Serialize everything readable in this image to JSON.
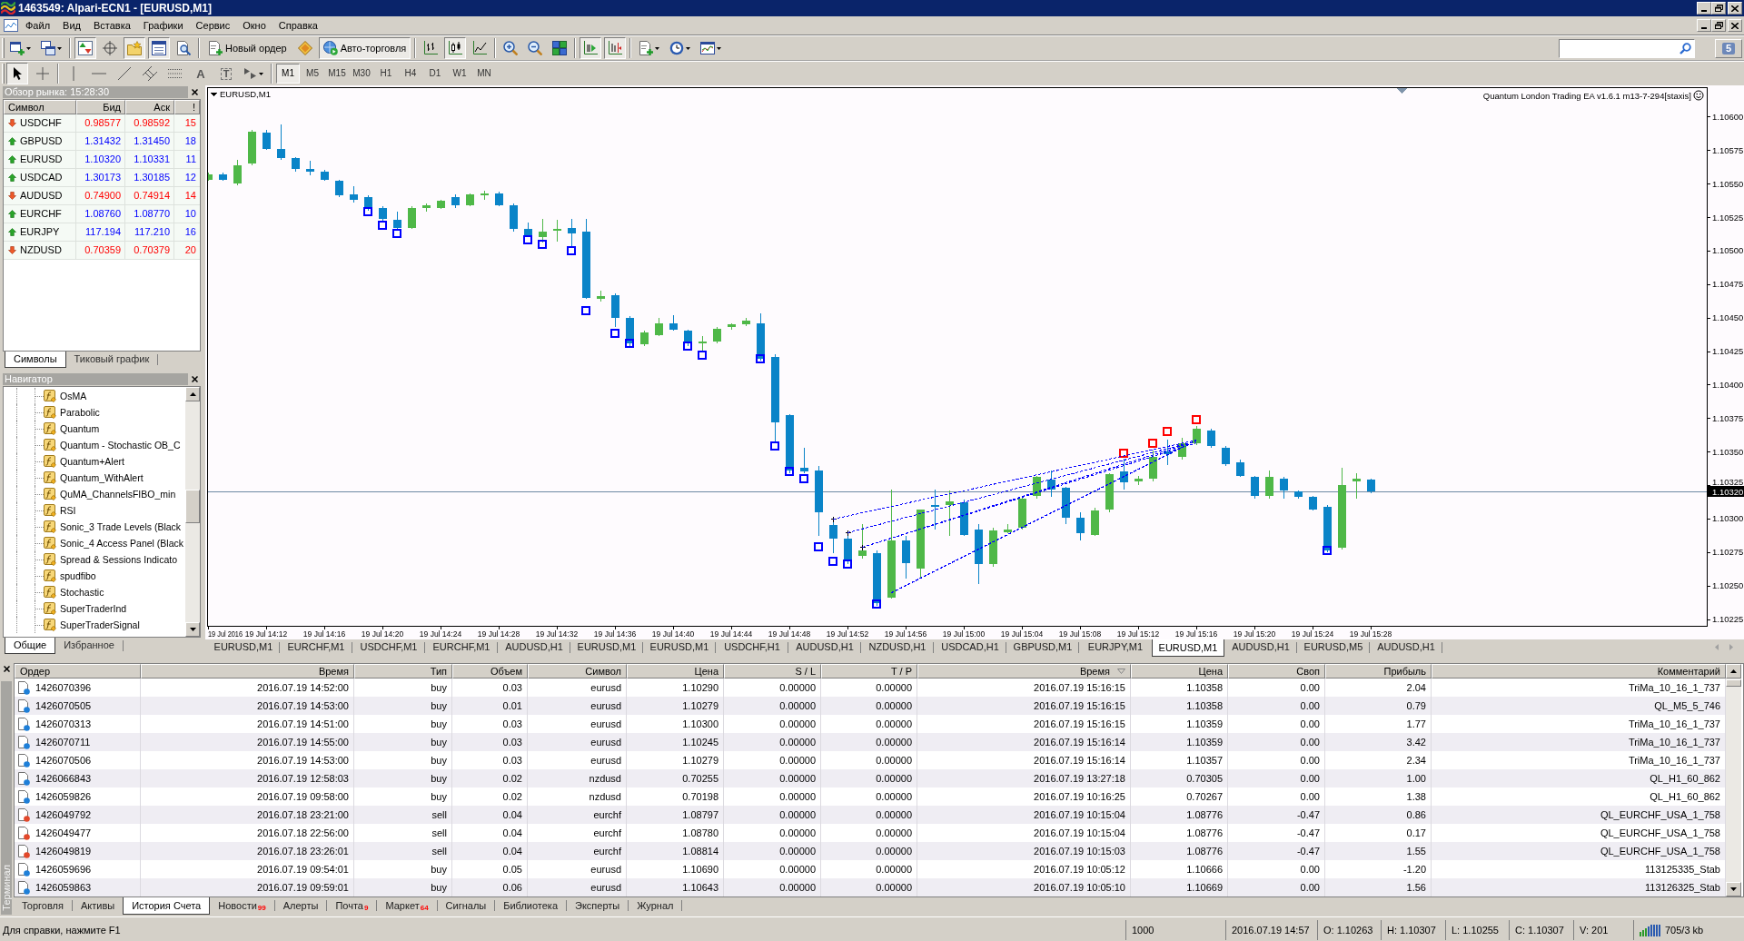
{
  "window": {
    "title": "1463549: Alpari-ECN1 - [EURUSD,M1]"
  },
  "menu": [
    "Файл",
    "Вид",
    "Вставка",
    "Графики",
    "Сервис",
    "Окно",
    "Справка"
  ],
  "toolbar": {
    "groups": [
      [
        {
          "kind": "icon",
          "on": false
        },
        {
          "kind": "icon",
          "on": false
        }
      ],
      [
        {
          "kind": "icon",
          "on": true
        },
        {
          "kind": "icon",
          "on": false
        },
        {
          "kind": "icon",
          "on": true
        },
        {
          "kind": "icon",
          "on": true
        },
        {
          "kind": "icon",
          "on": false
        }
      ],
      [
        {
          "kind": "button",
          "label": "Новый ордер",
          "on": false
        },
        {
          "kind": "icon",
          "on": false
        },
        {
          "kind": "button",
          "label": "Авто-торговля",
          "on": true
        }
      ],
      [
        {
          "kind": "icon",
          "on": false
        },
        {
          "kind": "icon",
          "on": true
        },
        {
          "kind": "icon",
          "on": false
        }
      ],
      [
        {
          "kind": "icon",
          "on": false
        },
        {
          "kind": "icon",
          "on": false
        },
        {
          "kind": "icon",
          "on": false
        }
      ],
      [
        {
          "kind": "icon",
          "on": true
        },
        {
          "kind": "icon",
          "on": true
        }
      ],
      [
        {
          "kind": "icon",
          "on": false
        },
        {
          "kind": "icon",
          "on": false
        },
        {
          "kind": "icon",
          "on": false
        }
      ]
    ],
    "messages": "5"
  },
  "drawing_toolbar": {
    "groups": [
      [
        {
          "kind": "icon",
          "on": true
        },
        {
          "kind": "icon",
          "on": false
        }
      ],
      [
        {
          "kind": "icon",
          "on": false
        },
        {
          "kind": "icon",
          "on": false
        },
        {
          "kind": "icon",
          "on": false
        },
        {
          "kind": "icon",
          "on": false
        },
        {
          "kind": "icon",
          "on": false
        },
        {
          "kind": "glyph",
          "label": "A",
          "on": false
        },
        {
          "kind": "boxed_glyph",
          "label": "T",
          "on": false
        },
        {
          "kind": "icon",
          "on": false
        }
      ]
    ],
    "timeframes": [
      {
        "label": "M1",
        "selected": true
      },
      {
        "label": "M5",
        "selected": false
      },
      {
        "label": "M15",
        "selected": false
      },
      {
        "label": "M30",
        "selected": false
      },
      {
        "label": "H1",
        "selected": false
      },
      {
        "label": "H4",
        "selected": false
      },
      {
        "label": "D1",
        "selected": false
      },
      {
        "label": "W1",
        "selected": false
      },
      {
        "label": "MN",
        "selected": false
      }
    ]
  },
  "market_watch": {
    "title": "Обзор рынка: 15:28:30",
    "columns": [
      "Символ",
      "Бид",
      "Аск",
      "!"
    ],
    "rows": [
      {
        "symbol": "USDCHF",
        "bid": "0.98577",
        "ask": "0.98592",
        "spread": "15",
        "rising": false
      },
      {
        "symbol": "GBPUSD",
        "bid": "1.31432",
        "ask": "1.31450",
        "spread": "18",
        "rising": true
      },
      {
        "symbol": "EURUSD",
        "bid": "1.10320",
        "ask": "1.10331",
        "spread": "11",
        "rising": true
      },
      {
        "symbol": "USDCAD",
        "bid": "1.30173",
        "ask": "1.30185",
        "spread": "12",
        "rising": true
      },
      {
        "symbol": "AUDUSD",
        "bid": "0.74900",
        "ask": "0.74914",
        "spread": "14",
        "rising": false
      },
      {
        "symbol": "EURCHF",
        "bid": "1.08760",
        "ask": "1.08770",
        "spread": "10",
        "rising": true
      },
      {
        "symbol": "EURJPY",
        "bid": "117.194",
        "ask": "117.210",
        "spread": "16",
        "rising": true
      },
      {
        "symbol": "NZDUSD",
        "bid": "0.70359",
        "ask": "0.70379",
        "spread": "20",
        "rising": false
      }
    ],
    "tabs": [
      {
        "label": "Символы",
        "selected": true
      },
      {
        "label": "Тиковый график",
        "selected": false
      }
    ]
  },
  "navigator": {
    "title": "Навигатор",
    "items": [
      "OsMA",
      "Parabolic",
      "Quantum",
      "Quantum - Stochastic OB_C",
      "Quantum+Alert",
      "Quantum_WithAlert",
      "QuMA_ChannelsFIBO_min",
      "RSI",
      "Sonic_3 Trade Levels (Black",
      "Sonic_4 Access Panel (Black",
      "Spread & Sessions Indicato",
      "spudfibo",
      "Stochastic",
      "SuperTraderInd",
      "SuperTraderSignal"
    ],
    "tabs": [
      {
        "label": "Общие",
        "selected": true
      },
      {
        "label": "Избранное",
        "selected": false
      }
    ]
  },
  "chart": {
    "chart_data": {
      "type": "candlestick",
      "title": "EURUSD,M1",
      "annotations": [
        "Quantum London Trading EA v1.6.1 m13-7-294[staxis]"
      ],
      "x": [
        "2016-07-19T14:08",
        "2016-07-19T14:09",
        "2016-07-19T14:10",
        "2016-07-19T14:11",
        "2016-07-19T14:12",
        "2016-07-19T14:13",
        "2016-07-19T14:14",
        "2016-07-19T14:15",
        "2016-07-19T14:16",
        "2016-07-19T14:17",
        "2016-07-19T14:18",
        "2016-07-19T14:19",
        "2016-07-19T14:20",
        "2016-07-19T14:21",
        "2016-07-19T14:22",
        "2016-07-19T14:23",
        "2016-07-19T14:24",
        "2016-07-19T14:25",
        "2016-07-19T14:26",
        "2016-07-19T14:27",
        "2016-07-19T14:28",
        "2016-07-19T14:29",
        "2016-07-19T14:30",
        "2016-07-19T14:31",
        "2016-07-19T14:32",
        "2016-07-19T14:33",
        "2016-07-19T14:34",
        "2016-07-19T14:35",
        "2016-07-19T14:36",
        "2016-07-19T14:37",
        "2016-07-19T14:38",
        "2016-07-19T14:39",
        "2016-07-19T14:40",
        "2016-07-19T14:41",
        "2016-07-19T14:42",
        "2016-07-19T14:43",
        "2016-07-19T14:44",
        "2016-07-19T14:45",
        "2016-07-19T14:46",
        "2016-07-19T14:47",
        "2016-07-19T14:48",
        "2016-07-19T14:49",
        "2016-07-19T14:50",
        "2016-07-19T14:51",
        "2016-07-19T14:52",
        "2016-07-19T14:53",
        "2016-07-19T14:54",
        "2016-07-19T14:55",
        "2016-07-19T14:56",
        "2016-07-19T14:57",
        "2016-07-19T14:58",
        "2016-07-19T14:59",
        "2016-07-19T15:00",
        "2016-07-19T15:01",
        "2016-07-19T15:02",
        "2016-07-19T15:03",
        "2016-07-19T15:04",
        "2016-07-19T15:05",
        "2016-07-19T15:06",
        "2016-07-19T15:07",
        "2016-07-19T15:08",
        "2016-07-19T15:09",
        "2016-07-19T15:10",
        "2016-07-19T15:11",
        "2016-07-19T15:12",
        "2016-07-19T15:13",
        "2016-07-19T15:14",
        "2016-07-19T15:15",
        "2016-07-19T15:16",
        "2016-07-19T15:17",
        "2016-07-19T15:18",
        "2016-07-19T15:19",
        "2016-07-19T15:20",
        "2016-07-19T15:21",
        "2016-07-19T15:22",
        "2016-07-19T15:23",
        "2016-07-19T15:24",
        "2016-07-19T15:25",
        "2016-07-19T15:26",
        "2016-07-19T15:27",
        "2016-07-19T15:28"
      ],
      "ohlc": [
        [
          1.10553,
          1.10558,
          1.10552,
          1.10557
        ],
        [
          1.10557,
          1.10558,
          1.10552,
          1.10553
        ],
        [
          1.1055,
          1.10568,
          1.10549,
          1.10564
        ],
        [
          1.10565,
          1.1059,
          1.10564,
          1.10589
        ],
        [
          1.10588,
          1.1059,
          1.10575,
          1.10576
        ],
        [
          1.10576,
          1.10594,
          1.10568,
          1.10569
        ],
        [
          1.10569,
          1.1057,
          1.10559,
          1.10561
        ],
        [
          1.10561,
          1.10567,
          1.10556,
          1.10559
        ],
        [
          1.10559,
          1.1056,
          1.10552,
          1.10553
        ],
        [
          1.10552,
          1.10553,
          1.1054,
          1.10541
        ],
        [
          1.10542,
          1.10548,
          1.10536,
          1.10538
        ],
        [
          1.1054,
          1.10541,
          1.1053,
          1.10531
        ],
        [
          1.10532,
          1.10533,
          1.10522,
          1.10524
        ],
        [
          1.10523,
          1.10529,
          1.10516,
          1.10517
        ],
        [
          1.10517,
          1.10533,
          1.10516,
          1.10532
        ],
        [
          1.10532,
          1.10535,
          1.10529,
          1.10534
        ],
        [
          1.10532,
          1.10538,
          1.10531,
          1.10537
        ],
        [
          1.1054,
          1.10542,
          1.10532,
          1.10534
        ],
        [
          1.10534,
          1.10543,
          1.10533,
          1.10542
        ],
        [
          1.10541,
          1.10545,
          1.10538,
          1.10543
        ],
        [
          1.10543,
          1.10544,
          1.10533,
          1.10534
        ],
        [
          1.10534,
          1.10535,
          1.10514,
          1.10516
        ],
        [
          1.10516,
          1.10521,
          1.1051,
          1.10511
        ],
        [
          1.1051,
          1.10524,
          1.10506,
          1.10514
        ],
        [
          1.10515,
          1.10523,
          1.10507,
          1.10516
        ],
        [
          1.10517,
          1.10524,
          1.10503,
          1.10513
        ],
        [
          1.10514,
          1.10524,
          1.10464,
          1.10465
        ],
        [
          1.10464,
          1.1047,
          1.10462,
          1.10466
        ],
        [
          1.10467,
          1.10468,
          1.10443,
          1.1045
        ],
        [
          1.1045,
          1.10451,
          1.10429,
          1.10431
        ],
        [
          1.1043,
          1.1044,
          1.10429,
          1.10439
        ],
        [
          1.10437,
          1.1045,
          1.10436,
          1.10446
        ],
        [
          1.10446,
          1.10452,
          1.1044,
          1.10441
        ],
        [
          1.1044,
          1.10441,
          1.10429,
          1.10431
        ],
        [
          1.10431,
          1.10436,
          1.10425,
          1.10432
        ],
        [
          1.10432,
          1.10443,
          1.10431,
          1.10442
        ],
        [
          1.10443,
          1.10446,
          1.10441,
          1.10445
        ],
        [
          1.10445,
          1.1045,
          1.10444,
          1.10448
        ],
        [
          1.10446,
          1.10453,
          1.10418,
          1.10419
        ],
        [
          1.10421,
          1.10423,
          1.10357,
          1.10372
        ],
        [
          1.10377,
          1.10378,
          1.10334,
          1.10336
        ],
        [
          1.10338,
          1.10353,
          1.10334,
          1.10335
        ],
        [
          1.10336,
          1.10339,
          1.10287,
          1.10305
        ],
        [
          1.10295,
          1.10297,
          1.10274,
          1.10285
        ],
        [
          1.10285,
          1.10287,
          1.10266,
          1.10268
        ],
        [
          1.10272,
          1.10296,
          1.1027,
          1.10276
        ],
        [
          1.10274,
          1.10276,
          1.10235,
          1.10237
        ],
        [
          1.10241,
          1.10322,
          1.1024,
          1.10284
        ],
        [
          1.10284,
          1.10287,
          1.10255,
          1.10267
        ],
        [
          1.10263,
          1.10307,
          1.10255,
          1.10307
        ],
        [
          1.1031,
          1.10322,
          1.10292,
          1.10309
        ],
        [
          1.1031,
          1.10321,
          1.10287,
          1.10313
        ],
        [
          1.10312,
          1.10314,
          1.10287,
          1.10288
        ],
        [
          1.10292,
          1.10296,
          1.10251,
          1.10266
        ],
        [
          1.10266,
          1.10293,
          1.10264,
          1.10291
        ],
        [
          1.1029,
          1.10296,
          1.10289,
          1.10292
        ],
        [
          1.10293,
          1.10317,
          1.10292,
          1.10315
        ],
        [
          1.10317,
          1.10332,
          1.10315,
          1.10331
        ],
        [
          1.10329,
          1.10336,
          1.10316,
          1.10322
        ],
        [
          1.10323,
          1.10324,
          1.10296,
          1.10301
        ],
        [
          1.10301,
          1.10305,
          1.10284,
          1.10289
        ],
        [
          1.10288,
          1.10308,
          1.10287,
          1.10306
        ],
        [
          1.10307,
          1.10334,
          1.10305,
          1.10333
        ],
        [
          1.10335,
          1.10345,
          1.10322,
          1.10327
        ],
        [
          1.10328,
          1.10332,
          1.10325,
          1.1033
        ],
        [
          1.1033,
          1.10351,
          1.10328,
          1.10346
        ],
        [
          1.1035,
          1.10359,
          1.1034,
          1.10348
        ],
        [
          1.10346,
          1.1036,
          1.10344,
          1.10356
        ],
        [
          1.10356,
          1.10369,
          1.10355,
          1.10367
        ],
        [
          1.10366,
          1.10367,
          1.10353,
          1.10354
        ],
        [
          1.10353,
          1.10354,
          1.10339,
          1.10341
        ],
        [
          1.10342,
          1.10344,
          1.10331,
          1.10332
        ],
        [
          1.10331,
          1.10332,
          1.10315,
          1.10317
        ],
        [
          1.10317,
          1.10336,
          1.10315,
          1.10331
        ],
        [
          1.1033,
          1.10331,
          1.10315,
          1.10321
        ],
        [
          1.1032,
          1.10321,
          1.10315,
          1.10316
        ],
        [
          1.10316,
          1.10317,
          1.10306,
          1.10307
        ],
        [
          1.10309,
          1.1031,
          1.10275,
          1.10276
        ],
        [
          1.10278,
          1.10338,
          1.10277,
          1.10325
        ],
        [
          1.10328,
          1.10334,
          1.10315,
          1.1033
        ],
        [
          1.10329,
          1.1033,
          1.10319,
          1.1032
        ]
      ],
      "colors": [
        "#4fb848",
        "#0a84c8",
        "#4fb848",
        "#4fb848",
        "#0a84c8",
        "#0a84c8",
        "#0a84c8",
        "#0a84c8",
        "#0a84c8",
        "#0a84c8",
        "#0a84c8",
        "#0a84c8",
        "#0a84c8",
        "#0a84c8",
        "#4fb848",
        "#4fb848",
        "#4fb848",
        "#0a84c8",
        "#4fb848",
        "#4fb848",
        "#0a84c8",
        "#0a84c8",
        "#0a84c8",
        "#4fb848",
        "#4fb848",
        "#0a84c8",
        "#0a84c8",
        "#4fb848",
        "#0a84c8",
        "#0a84c8",
        "#4fb848",
        "#4fb848",
        "#0a84c8",
        "#0a84c8",
        "#4fb848",
        "#4fb848",
        "#4fb848",
        "#4fb848",
        "#0a84c8",
        "#0a84c8",
        "#0a84c8",
        "#0a84c8",
        "#0a84c8",
        "#0a84c8",
        "#0a84c8",
        "#4fb848",
        "#0a84c8",
        "#4fb848",
        "#0a84c8",
        "#4fb848",
        "#0a84c8",
        "#4fb848",
        "#0a84c8",
        "#0a84c8",
        "#4fb848",
        "#4fb848",
        "#4fb848",
        "#4fb848",
        "#0a84c8",
        "#0a84c8",
        "#0a84c8",
        "#4fb848",
        "#4fb848",
        "#0a84c8",
        "#4fb848",
        "#4fb848",
        "#0a84c8",
        "#4fb848",
        "#4fb848",
        "#0a84c8",
        "#0a84c8",
        "#0a84c8",
        "#0a84c8",
        "#4fb848",
        "#0a84c8",
        "#0a84c8",
        "#0a84c8",
        "#0a84c8",
        "#4fb848",
        "#4fb848",
        "#0a84c8"
      ],
      "series": [
        {
          "type": "scatter",
          "marker": "square",
          "color": "#0000ff",
          "x": [
            "2016-07-19T14:19",
            "2016-07-19T14:20",
            "2016-07-19T14:21",
            "2016-07-19T14:30",
            "2016-07-19T14:31",
            "2016-07-19T14:33",
            "2016-07-19T14:34",
            "2016-07-19T14:36",
            "2016-07-19T14:37",
            "2016-07-19T14:41",
            "2016-07-19T14:42",
            "2016-07-19T14:46",
            "2016-07-19T14:47",
            "2016-07-19T14:48",
            "2016-07-19T14:49",
            "2016-07-19T14:50",
            "2016-07-19T14:51",
            "2016-07-19T14:52",
            "2016-07-19T14:54",
            "2016-07-19T15:25"
          ],
          "values": [
            1.10529,
            1.10519,
            1.10513,
            1.10508,
            1.10505,
            1.105,
            1.10455,
            1.10438,
            1.10431,
            1.10429,
            1.10422,
            1.10419,
            1.10354,
            1.10335,
            1.1033,
            1.10279,
            1.10268,
            1.10266,
            1.10236,
            1.10276
          ]
        },
        {
          "type": "scatter",
          "marker": "square",
          "color": "#ff0000",
          "x": [
            "2016-07-19T15:11",
            "2016-07-19T15:13",
            "2016-07-19T15:14",
            "2016-07-19T15:16"
          ],
          "values": [
            1.10349,
            1.10356,
            1.10365,
            1.10374
          ]
        },
        {
          "type": "scatter",
          "marker": "cross",
          "color": "#000000",
          "x": [
            "2016-07-19T14:51",
            "2016-07-19T14:52",
            "2016-07-19T14:53"
          ],
          "values": [
            1.103,
            1.1029,
            1.10279
          ]
        },
        {
          "type": "line",
          "line_style": "dotted",
          "color": "#0000ff",
          "x": [
            "2016-07-19T14:52",
            "2016-07-19T15:16"
          ],
          "values": [
            1.1029,
            1.10358
          ]
        },
        {
          "type": "line",
          "line_style": "dotted",
          "color": "#0000ff",
          "x": [
            "2016-07-19T14:53",
            "2016-07-19T15:16"
          ],
          "values": [
            1.10279,
            1.10358
          ]
        },
        {
          "type": "line",
          "line_style": "dotted",
          "color": "#0000ff",
          "x": [
            "2016-07-19T14:51",
            "2016-07-19T15:16"
          ],
          "values": [
            1.103,
            1.10359
          ]
        },
        {
          "type": "line",
          "line_style": "dotted",
          "color": "#0000ff",
          "x": [
            "2016-07-19T14:55",
            "2016-07-19T15:16"
          ],
          "values": [
            1.10245,
            1.10359
          ]
        },
        {
          "type": "line",
          "line_style": "dotted",
          "color": "#0000ff",
          "x": [
            "2016-07-19T14:53",
            "2016-07-19T15:16"
          ],
          "values": [
            1.10279,
            1.10357
          ]
        }
      ],
      "xlim": [
        "2016-07-19T14:08",
        "2016-07-19T15:51"
      ],
      "ylim": [
        1.1022,
        1.10622
      ],
      "xticks": [
        {
          "value": "2016-07-19T14:08",
          "label": "19 Jul 2016"
        },
        {
          "value": "2016-07-19T14:12",
          "label": "19 Jul 14:12"
        },
        {
          "value": "2016-07-19T14:16",
          "label": "19 Jul 14:16"
        },
        {
          "value": "2016-07-19T14:20",
          "label": "19 Jul 14:20"
        },
        {
          "value": "2016-07-19T14:24",
          "label": "19 Jul 14:24"
        },
        {
          "value": "2016-07-19T14:28",
          "label": "19 Jul 14:28"
        },
        {
          "value": "2016-07-19T14:32",
          "label": "19 Jul 14:32"
        },
        {
          "value": "2016-07-19T14:36",
          "label": "19 Jul 14:36"
        },
        {
          "value": "2016-07-19T14:40",
          "label": "19 Jul 14:40"
        },
        {
          "value": "2016-07-19T14:44",
          "label": "19 Jul 14:44"
        },
        {
          "value": "2016-07-19T14:48",
          "label": "19 Jul 14:48"
        },
        {
          "value": "2016-07-19T14:52",
          "label": "19 Jul 14:52"
        },
        {
          "value": "2016-07-19T14:56",
          "label": "19 Jul 14:56"
        },
        {
          "value": "2016-07-19T15:00",
          "label": "19 Jul 15:00"
        },
        {
          "value": "2016-07-19T15:04",
          "label": "19 Jul 15:04"
        },
        {
          "value": "2016-07-19T15:08",
          "label": "19 Jul 15:08"
        },
        {
          "value": "2016-07-19T15:12",
          "label": "19 Jul 15:12"
        },
        {
          "value": "2016-07-19T15:16",
          "label": "19 Jul 15:16"
        },
        {
          "value": "2016-07-19T15:20",
          "label": "19 Jul 15:20"
        },
        {
          "value": "2016-07-19T15:24",
          "label": "19 Jul 15:24"
        },
        {
          "value": "2016-07-19T15:28",
          "label": "19 Jul 15:28"
        }
      ],
      "yticks": [
        {
          "value": 1.106,
          "label": "1.10600"
        },
        {
          "value": 1.10575,
          "label": "1.10575"
        },
        {
          "value": 1.1055,
          "label": "1.10550"
        },
        {
          "value": 1.10525,
          "label": "1.10525"
        },
        {
          "value": 1.105,
          "label": "1.10500"
        },
        {
          "value": 1.10475,
          "label": "1.10475"
        },
        {
          "value": 1.1045,
          "label": "1.10450"
        },
        {
          "value": 1.10425,
          "label": "1.10425"
        },
        {
          "value": 1.104,
          "label": "1.10400"
        },
        {
          "value": 1.10375,
          "label": "1.10375"
        },
        {
          "value": 1.1035,
          "label": "1.10350"
        },
        {
          "value": 1.10325,
          "label": "1.10325"
        },
        {
          "value": 1.103,
          "label": "1.10300"
        },
        {
          "value": 1.10275,
          "label": "1.10275"
        },
        {
          "value": 1.1025,
          "label": "1.10250"
        },
        {
          "value": 1.10225,
          "label": "1.10225"
        }
      ],
      "ref_lines": [
        {
          "axis": "y",
          "value": 1.1032,
          "label": "1.10320",
          "color": "#6f8aa4"
        }
      ]
    }
  },
  "chart_tabs": [
    {
      "label": "EURUSD,M1",
      "selected": false
    },
    {
      "label": "EURCHF,M1",
      "selected": false
    },
    {
      "label": "USDCHF,M1",
      "selected": false
    },
    {
      "label": "EURCHF,M1",
      "selected": false
    },
    {
      "label": "AUDUSD,H1",
      "selected": false
    },
    {
      "label": "EURUSD,M1",
      "selected": false
    },
    {
      "label": "EURUSD,M1",
      "selected": false
    },
    {
      "label": "USDCHF,H1",
      "selected": false
    },
    {
      "label": "AUDUSD,H1",
      "selected": false
    },
    {
      "label": "NZDUSD,H1",
      "selected": false
    },
    {
      "label": "USDCAD,H1",
      "selected": false
    },
    {
      "label": "GBPUSD,M1",
      "selected": false
    },
    {
      "label": "EURJPY,M1",
      "selected": false
    },
    {
      "label": "EURUSD,M1",
      "selected": true
    },
    {
      "label": "AUDUSD,H1",
      "selected": false
    },
    {
      "label": "EURUSD,M5",
      "selected": false
    },
    {
      "label": "AUDUSD,H1",
      "selected": false
    }
  ],
  "terminal": {
    "label": "Терминал",
    "columns": [
      {
        "label": "Ордер",
        "sorted": false
      },
      {
        "label": "Время",
        "sorted": false
      },
      {
        "label": "Тип",
        "sorted": false
      },
      {
        "label": "Объем",
        "sorted": false
      },
      {
        "label": "Символ",
        "sorted": false
      },
      {
        "label": "Цена",
        "sorted": false
      },
      {
        "label": "S / L",
        "sorted": false
      },
      {
        "label": "T / P",
        "sorted": false
      },
      {
        "label": "Время",
        "sorted": true
      },
      {
        "label": "Цена",
        "sorted": false
      },
      {
        "label": "Своп",
        "sorted": false
      },
      {
        "label": "Прибыль",
        "sorted": false
      },
      {
        "label": "Комментарий",
        "sorted": false
      }
    ],
    "rows": [
      {
        "kind": "buy",
        "cells": [
          "1426070396",
          "2016.07.19 14:52:00",
          "buy",
          "0.03",
          "eurusd",
          "1.10290",
          "0.00000",
          "0.00000",
          "2016.07.19 15:16:15",
          "1.10358",
          "0.00",
          "2.04",
          "TriMa_10_16_1_737"
        ]
      },
      {
        "kind": "buy",
        "cells": [
          "1426070505",
          "2016.07.19 14:53:00",
          "buy",
          "0.01",
          "eurusd",
          "1.10279",
          "0.00000",
          "0.00000",
          "2016.07.19 15:16:15",
          "1.10358",
          "0.00",
          "0.79",
          "QL_M5_5_746"
        ]
      },
      {
        "kind": "buy",
        "cells": [
          "1426070313",
          "2016.07.19 14:51:00",
          "buy",
          "0.03",
          "eurusd",
          "1.10300",
          "0.00000",
          "0.00000",
          "2016.07.19 15:16:15",
          "1.10359",
          "0.00",
          "1.77",
          "TriMa_10_16_1_737"
        ]
      },
      {
        "kind": "buy",
        "cells": [
          "1426070711",
          "2016.07.19 14:55:00",
          "buy",
          "0.03",
          "eurusd",
          "1.10245",
          "0.00000",
          "0.00000",
          "2016.07.19 15:16:14",
          "1.10359",
          "0.00",
          "3.42",
          "TriMa_10_16_1_737"
        ]
      },
      {
        "kind": "buy",
        "cells": [
          "1426070506",
          "2016.07.19 14:53:00",
          "buy",
          "0.03",
          "eurusd",
          "1.10279",
          "0.00000",
          "0.00000",
          "2016.07.19 15:16:14",
          "1.10357",
          "0.00",
          "2.34",
          "TriMa_10_16_1_737"
        ]
      },
      {
        "kind": "buy",
        "cells": [
          "1426066843",
          "2016.07.19 12:58:03",
          "buy",
          "0.02",
          "nzdusd",
          "0.70255",
          "0.00000",
          "0.00000",
          "2016.07.19 13:27:18",
          "0.70305",
          "0.00",
          "1.00",
          "QL_H1_60_862"
        ]
      },
      {
        "kind": "buy",
        "cells": [
          "1426059826",
          "2016.07.19 09:58:00",
          "buy",
          "0.02",
          "nzdusd",
          "0.70198",
          "0.00000",
          "0.00000",
          "2016.07.19 10:16:25",
          "0.70267",
          "0.00",
          "1.38",
          "QL_H1_60_862"
        ]
      },
      {
        "kind": "sell",
        "cells": [
          "1426049792",
          "2016.07.18 23:21:00",
          "sell",
          "0.04",
          "eurchf",
          "1.08797",
          "0.00000",
          "0.00000",
          "2016.07.19 10:15:04",
          "1.08776",
          "-0.47",
          "0.86",
          "QL_EURCHF_USA_1_758"
        ]
      },
      {
        "kind": "sell",
        "cells": [
          "1426049477",
          "2016.07.18 22:56:00",
          "sell",
          "0.04",
          "eurchf",
          "1.08780",
          "0.00000",
          "0.00000",
          "2016.07.19 10:15:04",
          "1.08776",
          "-0.47",
          "0.17",
          "QL_EURCHF_USA_1_758"
        ]
      },
      {
        "kind": "sell",
        "cells": [
          "1426049819",
          "2016.07.18 23:26:01",
          "sell",
          "0.04",
          "eurchf",
          "1.08814",
          "0.00000",
          "0.00000",
          "2016.07.19 10:15:03",
          "1.08776",
          "-0.47",
          "1.55",
          "QL_EURCHF_USA_1_758"
        ]
      },
      {
        "kind": "buy",
        "cells": [
          "1426059696",
          "2016.07.19 09:54:01",
          "buy",
          "0.05",
          "eurusd",
          "1.10690",
          "0.00000",
          "0.00000",
          "2016.07.19 10:05:12",
          "1.10666",
          "0.00",
          "-1.20",
          "113125335_Stab"
        ]
      },
      {
        "kind": "buy",
        "cells": [
          "1426059863",
          "2016.07.19 09:59:01",
          "buy",
          "0.06",
          "eurusd",
          "1.10643",
          "0.00000",
          "0.00000",
          "2016.07.19 10:05:10",
          "1.10669",
          "0.00",
          "1.56",
          "113126325_Stab"
        ]
      }
    ],
    "tabs": [
      {
        "label": "Торговля",
        "selected": false
      },
      {
        "label": "Активы",
        "selected": false
      },
      {
        "label": "История Счета",
        "selected": true
      },
      {
        "label": "Новости",
        "badge": "99",
        "selected": false
      },
      {
        "label": "Алерты",
        "selected": false
      },
      {
        "label": "Почта",
        "badge": "9",
        "selected": false
      },
      {
        "label": "Маркет",
        "badge": "64",
        "selected": false
      },
      {
        "label": "Сигналы",
        "selected": false
      },
      {
        "label": "Библиотека",
        "selected": false
      },
      {
        "label": "Эксперты",
        "selected": false
      },
      {
        "label": "Журнал",
        "selected": false
      }
    ]
  },
  "status_bar": {
    "help": "Для справки, нажмите F1",
    "cells": [
      "1000",
      "2016.07.19 14:57",
      "O: 1.10263",
      "H: 1.10307",
      "L: 1.10255",
      "C: 1.10307",
      "V: 201"
    ],
    "traffic": "705/3 kb"
  }
}
